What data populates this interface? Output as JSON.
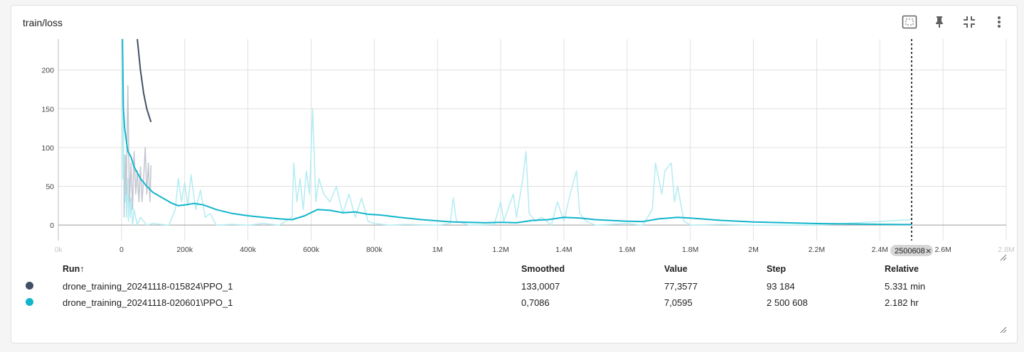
{
  "card": {
    "title": "train/loss",
    "toolbar": [
      {
        "name": "fit-domain-icon"
      },
      {
        "name": "pin-icon"
      },
      {
        "name": "collapse-icon"
      },
      {
        "name": "more-vert-icon"
      }
    ]
  },
  "colors": {
    "run1": "#425066",
    "run2": "#12b5cb",
    "run2_raw": "#b3ecf3",
    "run1_raw": "#c3c6d1",
    "grid": "#e0e0e0",
    "hover_line": "#000000"
  },
  "chart_data": {
    "type": "line",
    "title": "train/loss",
    "xlabel": "",
    "ylabel": "",
    "xlim": [
      -200000,
      2800000
    ],
    "ylim": [
      -20,
      240
    ],
    "x_ticks": [
      "0k",
      "0",
      "200k",
      "400k",
      "600k",
      "800k",
      "1M",
      "1.2M",
      "1.4M",
      "1.6M",
      "1.8M",
      "2M",
      "2.2M",
      "2.4M",
      "2.6M",
      "2.8M"
    ],
    "y_ticks": [
      "0",
      "50",
      "100",
      "150",
      "200"
    ],
    "hover_step": 2500608,
    "hover_label": "2500608",
    "series": [
      {
        "name": "drone_training_20241118-015824\\PPO_1",
        "smoothed": [
          [
            50000,
            240
          ],
          [
            60000,
            200
          ],
          [
            70000,
            170
          ],
          [
            80000,
            150
          ],
          [
            93184,
            133
          ]
        ],
        "raw": [
          [
            8000,
            10
          ],
          [
            12000,
            90
          ],
          [
            15000,
            40
          ],
          [
            20000,
            180
          ],
          [
            25000,
            30
          ],
          [
            30000,
            80
          ],
          [
            35000,
            20
          ],
          [
            40000,
            95
          ],
          [
            45000,
            40
          ],
          [
            50000,
            70
          ],
          [
            55000,
            30
          ],
          [
            60000,
            75
          ],
          [
            65000,
            30
          ],
          [
            70000,
            60
          ],
          [
            75000,
            100
          ],
          [
            80000,
            40
          ],
          [
            85000,
            80
          ],
          [
            90000,
            30
          ],
          [
            93184,
            77
          ]
        ]
      },
      {
        "name": "drone_training_20241118-020601\\PPO_1",
        "smoothed": [
          [
            3000,
            240
          ],
          [
            6000,
            150
          ],
          [
            10000,
            125
          ],
          [
            15000,
            110
          ],
          [
            20000,
            95
          ],
          [
            30000,
            88
          ],
          [
            40000,
            75
          ],
          [
            60000,
            60
          ],
          [
            80000,
            50
          ],
          [
            100000,
            42
          ],
          [
            130000,
            35
          ],
          [
            160000,
            28
          ],
          [
            180000,
            25
          ],
          [
            200000,
            26
          ],
          [
            230000,
            28
          ],
          [
            260000,
            26
          ],
          [
            300000,
            20
          ],
          [
            350000,
            15
          ],
          [
            400000,
            12
          ],
          [
            450000,
            10
          ],
          [
            500000,
            8
          ],
          [
            540000,
            7
          ],
          [
            580000,
            12
          ],
          [
            620000,
            20
          ],
          [
            660000,
            19
          ],
          [
            700000,
            16
          ],
          [
            740000,
            17
          ],
          [
            780000,
            14
          ],
          [
            820000,
            13
          ],
          [
            880000,
            10
          ],
          [
            950000,
            7
          ],
          [
            1050000,
            4
          ],
          [
            1150000,
            3
          ],
          [
            1200000,
            3.5
          ],
          [
            1250000,
            3
          ],
          [
            1300000,
            6
          ],
          [
            1350000,
            7
          ],
          [
            1400000,
            10
          ],
          [
            1450000,
            9
          ],
          [
            1500000,
            7
          ],
          [
            1600000,
            5
          ],
          [
            1650000,
            4.5
          ],
          [
            1700000,
            8
          ],
          [
            1760000,
            10
          ],
          [
            1800000,
            9
          ],
          [
            1900000,
            6
          ],
          [
            2000000,
            4
          ],
          [
            2100000,
            3
          ],
          [
            2200000,
            2
          ],
          [
            2300000,
            1.5
          ],
          [
            2400000,
            1
          ],
          [
            2500608,
            0.71
          ]
        ],
        "raw": [
          [
            2000,
            200
          ],
          [
            4000,
            60
          ],
          [
            6000,
            140
          ],
          [
            8000,
            20
          ],
          [
            10000,
            90
          ],
          [
            12000,
            30
          ],
          [
            14000,
            70
          ],
          [
            16000,
            10
          ],
          [
            18000,
            45
          ],
          [
            20000,
            60
          ],
          [
            22000,
            5
          ],
          [
            25000,
            50
          ],
          [
            28000,
            10
          ],
          [
            30000,
            35
          ],
          [
            35000,
            0
          ],
          [
            40000,
            20
          ],
          [
            50000,
            0
          ],
          [
            60000,
            10
          ],
          [
            80000,
            0
          ],
          [
            100000,
            2
          ],
          [
            150000,
            0
          ],
          [
            170000,
            20
          ],
          [
            180000,
            60
          ],
          [
            190000,
            30
          ],
          [
            200000,
            55
          ],
          [
            210000,
            25
          ],
          [
            220000,
            65
          ],
          [
            235000,
            20
          ],
          [
            250000,
            45
          ],
          [
            265000,
            10
          ],
          [
            280000,
            15
          ],
          [
            300000,
            0
          ],
          [
            350000,
            1
          ],
          [
            400000,
            0
          ],
          [
            450000,
            2
          ],
          [
            500000,
            0
          ],
          [
            540000,
            10
          ],
          [
            545000,
            80
          ],
          [
            555000,
            30
          ],
          [
            565000,
            60
          ],
          [
            575000,
            20
          ],
          [
            585000,
            70
          ],
          [
            595000,
            40
          ],
          [
            605000,
            150
          ],
          [
            615000,
            30
          ],
          [
            625000,
            60
          ],
          [
            640000,
            40
          ],
          [
            660000,
            30
          ],
          [
            680000,
            50
          ],
          [
            700000,
            15
          ],
          [
            720000,
            40
          ],
          [
            740000,
            10
          ],
          [
            760000,
            35
          ],
          [
            780000,
            5
          ],
          [
            800000,
            2
          ],
          [
            850000,
            0
          ],
          [
            900000,
            1
          ],
          [
            1000000,
            0
          ],
          [
            1040000,
            2
          ],
          [
            1050000,
            35
          ],
          [
            1060000,
            5
          ],
          [
            1100000,
            0
          ],
          [
            1180000,
            1
          ],
          [
            1200000,
            30
          ],
          [
            1210000,
            5
          ],
          [
            1240000,
            40
          ],
          [
            1250000,
            10
          ],
          [
            1270000,
            60
          ],
          [
            1280000,
            95
          ],
          [
            1290000,
            15
          ],
          [
            1310000,
            5
          ],
          [
            1330000,
            10
          ],
          [
            1360000,
            0
          ],
          [
            1380000,
            30
          ],
          [
            1400000,
            5
          ],
          [
            1420000,
            40
          ],
          [
            1440000,
            70
          ],
          [
            1450000,
            15
          ],
          [
            1470000,
            5
          ],
          [
            1500000,
            0
          ],
          [
            1600000,
            2
          ],
          [
            1650000,
            0
          ],
          [
            1680000,
            20
          ],
          [
            1690000,
            80
          ],
          [
            1710000,
            40
          ],
          [
            1720000,
            70
          ],
          [
            1740000,
            80
          ],
          [
            1750000,
            30
          ],
          [
            1760000,
            50
          ],
          [
            1780000,
            5
          ],
          [
            1800000,
            0
          ],
          [
            1900000,
            1
          ],
          [
            2000000,
            0
          ],
          [
            2200000,
            0
          ],
          [
            2500608,
            7.06
          ]
        ]
      }
    ]
  },
  "table": {
    "headers": {
      "run": "Run",
      "sort_arrow": "↑",
      "smoothed": "Smoothed",
      "value": "Value",
      "step": "Step",
      "relative": "Relative"
    },
    "rows": [
      {
        "run": "drone_training_20241118-015824\\PPO_1",
        "smoothed": "133,0007",
        "value": "77,3577",
        "step": "93 184",
        "relative": "5.331 min"
      },
      {
        "run": "drone_training_20241118-020601\\PPO_1",
        "smoothed": "0,7086",
        "value": "7,0595",
        "step": "2 500 608",
        "relative": "2.182 hr"
      }
    ]
  }
}
